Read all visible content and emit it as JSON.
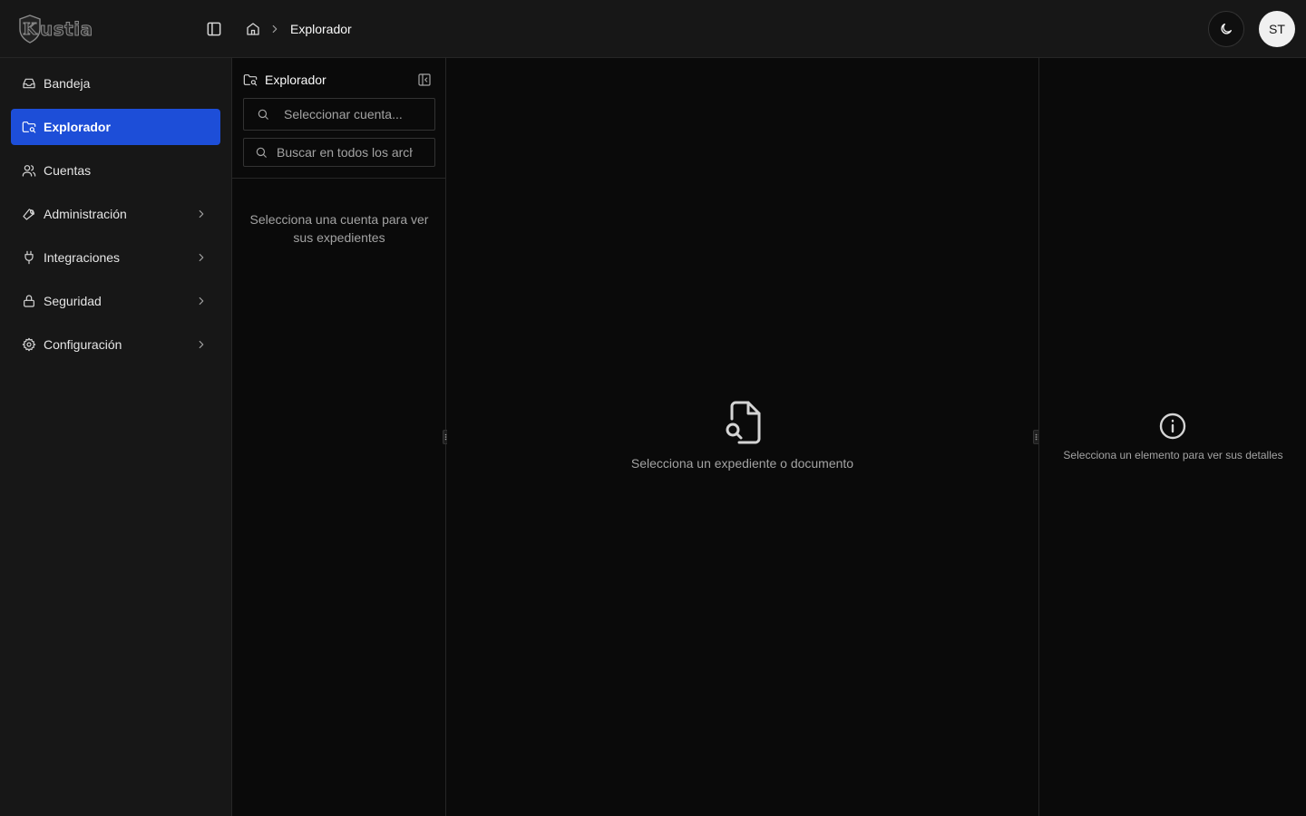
{
  "app": {
    "logo_letter": "K",
    "logo_text": "ustia"
  },
  "topbar": {
    "breadcrumb": {
      "current": "Explorador"
    },
    "user_initials": "ST"
  },
  "sidebar": {
    "items": [
      {
        "label": "Bandeja",
        "icon": "inbox-icon",
        "active": false,
        "expandable": false
      },
      {
        "label": "Explorador",
        "icon": "folder-search-icon",
        "active": true,
        "expandable": false
      },
      {
        "label": "Cuentas",
        "icon": "users-icon",
        "active": false,
        "expandable": false
      },
      {
        "label": "Administración",
        "icon": "wrench-icon",
        "active": false,
        "expandable": true
      },
      {
        "label": "Integraciones",
        "icon": "plug-icon",
        "active": false,
        "expandable": true
      },
      {
        "label": "Seguridad",
        "icon": "lock-icon",
        "active": false,
        "expandable": true
      },
      {
        "label": "Configuración",
        "icon": "gear-icon",
        "active": false,
        "expandable": true
      }
    ]
  },
  "explorer": {
    "title": "Explorador",
    "account_select": {
      "placeholder": "Seleccionar cuenta..."
    },
    "search": {
      "placeholder": "Buscar en todos los archivos..."
    },
    "empty_message": "Selecciona una cuenta para ver sus expedientes"
  },
  "main": {
    "empty_message": "Selecciona un expediente o documento"
  },
  "details": {
    "empty_message": "Selecciona un elemento para ver sus detalles"
  },
  "colors": {
    "accent": "#1d4ed8",
    "background": "#0a0a0a",
    "panel": "#171717",
    "border": "#262626",
    "muted_text": "#a3a3a3"
  }
}
